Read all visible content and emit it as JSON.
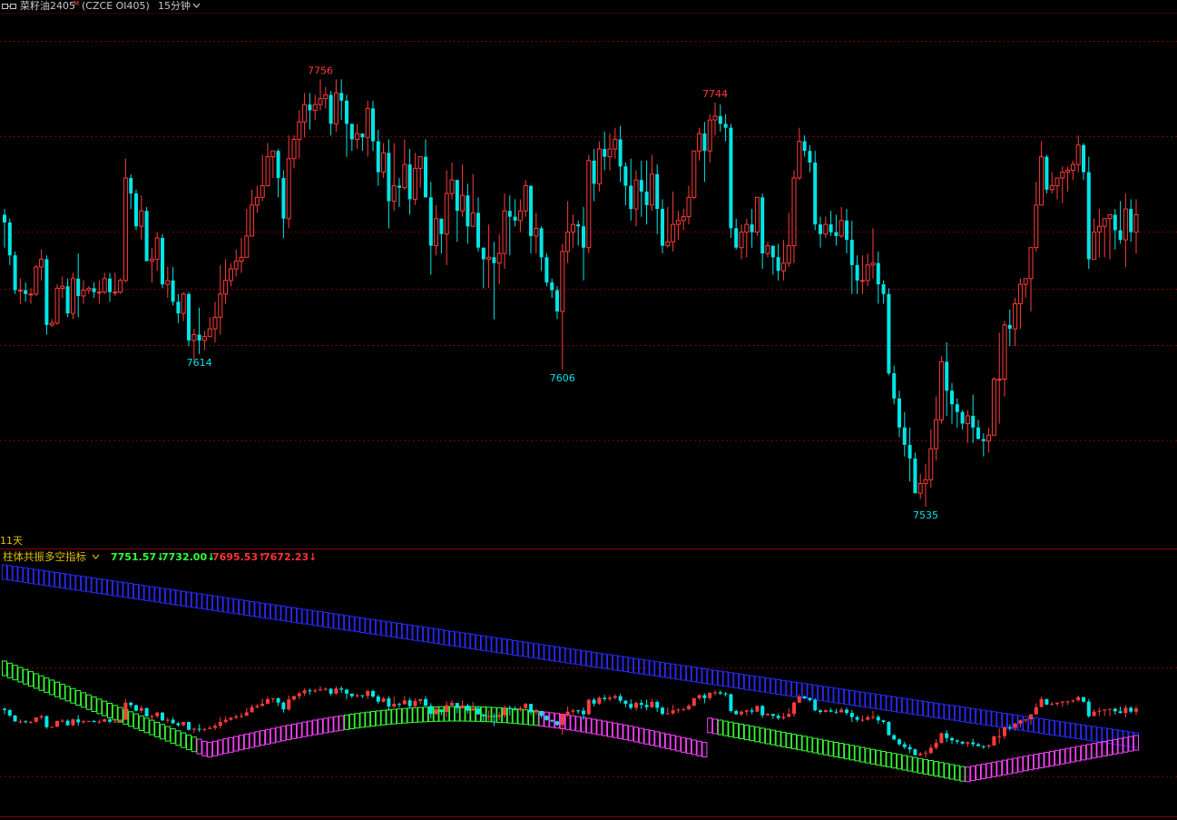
{
  "header": {
    "icon": "link-icon",
    "symbol_name": "菜籽油2405",
    "symbol_sup": "M",
    "exchange_code": "(CZCE OI405)",
    "period": "15分钟",
    "period_icon": "chevron-down-icon"
  },
  "main_panel": {
    "corner_label": "11天",
    "colors": {
      "up": "#ff3b3b",
      "down": "#00e5e5",
      "grid": "#7a0000",
      "background": "#000000"
    }
  },
  "indicator_panel": {
    "title": "柱体共振多空指标",
    "title_icon": "chevron-down-icon",
    "values": [
      {
        "text": "7751.57↓",
        "color": "#33ff33"
      },
      {
        "text": "7732.00↓",
        "color": "#33ff33"
      },
      {
        "text": "7695.53↑",
        "color": "#ff3333"
      },
      {
        "text": "7672.23↓",
        "color": "#ff3333"
      }
    ],
    "band_colors": {
      "slow": "#2a2aff",
      "fast_up": "#ff40ff",
      "fast_down": "#33ff33"
    }
  },
  "chart_data": {
    "type": "candlestick",
    "title": "菜籽油2405 15分钟",
    "y_range": [
      7520,
      7790
    ],
    "annotations": [
      {
        "label": "7756",
        "value": 7756,
        "kind": "high"
      },
      {
        "label": "7614",
        "value": 7614,
        "kind": "low"
      },
      {
        "label": "7606",
        "value": 7606,
        "kind": "low"
      },
      {
        "label": "7744",
        "value": 7744,
        "kind": "high"
      },
      {
        "label": "7535",
        "value": 7535,
        "kind": "low"
      }
    ],
    "candles": [
      [
        7686,
        7682,
        7689,
        7669
      ],
      [
        7682,
        7665,
        7684,
        7660
      ],
      [
        7665,
        7647,
        7667,
        7645
      ],
      [
        7647,
        7647,
        7653,
        7640
      ],
      [
        7647,
        7645,
        7651,
        7641
      ],
      [
        7645,
        7645,
        7648,
        7640
      ],
      [
        7645,
        7659,
        7660,
        7644
      ],
      [
        7659,
        7663,
        7668,
        7652
      ],
      [
        7663,
        7629,
        7665,
        7624
      ],
      [
        7629,
        7630,
        7632,
        7628
      ],
      [
        7630,
        7648,
        7650,
        7629
      ],
      [
        7648,
        7649,
        7654,
        7643
      ],
      [
        7649,
        7635,
        7653,
        7633
      ],
      [
        7635,
        7653,
        7656,
        7632
      ],
      [
        7653,
        7644,
        7666,
        7633
      ],
      [
        7644,
        7647,
        7652,
        7640
      ],
      [
        7647,
        7648,
        7649,
        7645
      ],
      [
        7648,
        7646,
        7651,
        7643
      ],
      [
        7646,
        7646,
        7652,
        7640
      ],
      [
        7646,
        7653,
        7656,
        7645
      ],
      [
        7653,
        7646,
        7656,
        7641
      ],
      [
        7646,
        7646,
        7656,
        7644
      ],
      [
        7646,
        7652,
        7653,
        7645
      ],
      [
        7652,
        7705,
        7715,
        7651
      ],
      [
        7705,
        7697,
        7707,
        7689
      ],
      [
        7697,
        7680,
        7699,
        7678
      ],
      [
        7680,
        7688,
        7696,
        7673
      ],
      [
        7688,
        7662,
        7690,
        7662
      ],
      [
        7662,
        7663,
        7669,
        7651
      ],
      [
        7663,
        7674,
        7677,
        7657
      ],
      [
        7674,
        7650,
        7676,
        7648
      ],
      [
        7650,
        7652,
        7659,
        7643
      ],
      [
        7652,
        7641,
        7659,
        7639
      ],
      [
        7641,
        7635,
        7645,
        7630
      ],
      [
        7635,
        7645,
        7646,
        7631
      ],
      [
        7645,
        7621,
        7646,
        7618
      ],
      [
        7621,
        7624,
        7627,
        7611
      ],
      [
        7624,
        7621,
        7638,
        7614
      ],
      [
        7621,
        7623,
        7626,
        7616
      ],
      [
        7623,
        7627,
        7633,
        7627
      ],
      [
        7627,
        7633,
        7641,
        7620
      ],
      [
        7633,
        7645,
        7660,
        7624
      ],
      [
        7645,
        7652,
        7663,
        7640
      ],
      [
        7652,
        7658,
        7661,
        7649
      ],
      [
        7658,
        7662,
        7668,
        7654
      ],
      [
        7662,
        7664,
        7674,
        7656
      ],
      [
        7664,
        7675,
        7689,
        7671
      ],
      [
        7675,
        7691,
        7699,
        7680
      ],
      [
        7691,
        7695,
        7701,
        7687
      ],
      [
        7695,
        7701,
        7717,
        7693
      ],
      [
        7701,
        7716,
        7723,
        7707
      ],
      [
        7716,
        7719,
        7719,
        7705
      ],
      [
        7719,
        7705,
        7720,
        7695
      ],
      [
        7705,
        7684,
        7709,
        7674
      ],
      [
        7684,
        7715,
        7727,
        7679
      ],
      [
        7715,
        7725,
        7727,
        7710
      ],
      [
        7725,
        7734,
        7740,
        7715
      ],
      [
        7734,
        7743,
        7749,
        7726
      ],
      [
        7743,
        7740,
        7749,
        7730
      ],
      [
        7740,
        7743,
        7748,
        7735
      ],
      [
        7743,
        7746,
        7756,
        7740
      ],
      [
        7746,
        7748,
        7752,
        7741
      ],
      [
        7748,
        7733,
        7750,
        7727
      ],
      [
        7733,
        7749,
        7756,
        7729
      ],
      [
        7749,
        7745,
        7756,
        7735
      ],
      [
        7745,
        7733,
        7748,
        7716
      ],
      [
        7733,
        7725,
        7733,
        7719
      ],
      [
        7725,
        7728,
        7733,
        7720
      ],
      [
        7728,
        7726,
        7728,
        7719
      ],
      [
        7726,
        7741,
        7745,
        7716
      ],
      [
        7741,
        7724,
        7745,
        7719
      ],
      [
        7724,
        7708,
        7730,
        7701
      ],
      [
        7708,
        7718,
        7723,
        7705
      ],
      [
        7718,
        7693,
        7725,
        7679
      ],
      [
        7693,
        7701,
        7723,
        7688
      ],
      [
        7701,
        7700,
        7705,
        7690
      ],
      [
        7700,
        7712,
        7725,
        7699
      ],
      [
        7712,
        7694,
        7720,
        7686
      ],
      [
        7694,
        7710,
        7718,
        7691
      ],
      [
        7710,
        7716,
        7716,
        7700
      ],
      [
        7716,
        7695,
        7725,
        7695
      ],
      [
        7695,
        7670,
        7703,
        7655
      ],
      [
        7670,
        7684,
        7691,
        7665
      ],
      [
        7684,
        7676,
        7678,
        7666
      ],
      [
        7676,
        7697,
        7709,
        7660
      ],
      [
        7697,
        7704,
        7713,
        7694
      ],
      [
        7704,
        7688,
        7704,
        7672
      ],
      [
        7688,
        7696,
        7712,
        7685
      ],
      [
        7696,
        7680,
        7702,
        7671
      ],
      [
        7680,
        7687,
        7707,
        7680
      ],
      [
        7687,
        7669,
        7695,
        7667
      ],
      [
        7669,
        7663,
        7669,
        7648
      ],
      [
        7663,
        7664,
        7681,
        7648
      ],
      [
        7664,
        7661,
        7672,
        7632
      ],
      [
        7661,
        7666,
        7676,
        7650
      ],
      [
        7666,
        7688,
        7697,
        7658
      ],
      [
        7688,
        7685,
        7696,
        7665
      ],
      [
        7685,
        7683,
        7694,
        7680
      ],
      [
        7683,
        7688,
        7694,
        7677
      ],
      [
        7688,
        7701,
        7704,
        7685
      ],
      [
        7701,
        7675,
        7701,
        7666
      ],
      [
        7675,
        7679,
        7687,
        7666
      ],
      [
        7679,
        7664,
        7680,
        7657
      ],
      [
        7664,
        7651,
        7666,
        7649
      ],
      [
        7651,
        7647,
        7653,
        7643
      ],
      [
        7647,
        7636,
        7649,
        7632
      ],
      [
        7636,
        7667,
        7671,
        7606
      ],
      [
        7667,
        7677,
        7693,
        7661
      ],
      [
        7677,
        7681,
        7686,
        7669
      ],
      [
        7681,
        7680,
        7683,
        7670
      ],
      [
        7680,
        7669,
        7690,
        7652
      ],
      [
        7669,
        7714,
        7717,
        7666
      ],
      [
        7714,
        7702,
        7720,
        7693
      ],
      [
        7702,
        7720,
        7724,
        7698
      ],
      [
        7720,
        7716,
        7729,
        7709
      ],
      [
        7716,
        7720,
        7728,
        7709
      ],
      [
        7720,
        7725,
        7731,
        7715
      ],
      [
        7725,
        7711,
        7732,
        7703
      ],
      [
        7711,
        7701,
        7713,
        7691
      ],
      [
        7701,
        7689,
        7715,
        7683
      ],
      [
        7689,
        7704,
        7709,
        7680
      ],
      [
        7704,
        7698,
        7714,
        7685
      ],
      [
        7698,
        7691,
        7714,
        7681
      ],
      [
        7691,
        7707,
        7717,
        7688
      ],
      [
        7707,
        7689,
        7712,
        7676
      ],
      [
        7689,
        7670,
        7694,
        7666
      ],
      [
        7670,
        7672,
        7690,
        7669
      ],
      [
        7672,
        7681,
        7698,
        7667
      ],
      [
        7681,
        7683,
        7688,
        7673
      ],
      [
        7683,
        7685,
        7689,
        7678
      ],
      [
        7685,
        7695,
        7701,
        7681
      ],
      [
        7695,
        7719,
        7719,
        7694
      ],
      [
        7719,
        7728,
        7731,
        7714
      ],
      [
        7728,
        7719,
        7734,
        7703
      ],
      [
        7719,
        7735,
        7738,
        7713
      ],
      [
        7735,
        7737,
        7744,
        7727
      ],
      [
        7737,
        7733,
        7743,
        7729
      ],
      [
        7733,
        7731,
        7738,
        7724
      ],
      [
        7731,
        7679,
        7733,
        7674
      ],
      [
        7679,
        7669,
        7684,
        7668
      ],
      [
        7669,
        7677,
        7681,
        7663
      ],
      [
        7677,
        7681,
        7684,
        7664
      ],
      [
        7681,
        7677,
        7689,
        7669
      ],
      [
        7677,
        7695,
        7695,
        7675
      ],
      [
        7695,
        7666,
        7697,
        7658
      ],
      [
        7666,
        7670,
        7672,
        7664
      ],
      [
        7670,
        7664,
        7670,
        7655
      ],
      [
        7664,
        7657,
        7671,
        7652
      ],
      [
        7657,
        7661,
        7673,
        7652
      ],
      [
        7661,
        7670,
        7687,
        7659
      ],
      [
        7670,
        7705,
        7709,
        7661
      ],
      [
        7705,
        7724,
        7731,
        7704
      ],
      [
        7724,
        7719,
        7727,
        7716
      ],
      [
        7719,
        7713,
        7722,
        7708
      ],
      [
        7713,
        7681,
        7719,
        7678
      ],
      [
        7681,
        7676,
        7685,
        7669
      ],
      [
        7676,
        7681,
        7685,
        7674
      ],
      [
        7681,
        7677,
        7688,
        7675
      ],
      [
        7677,
        7675,
        7686,
        7670
      ],
      [
        7675,
        7683,
        7690,
        7674
      ],
      [
        7683,
        7673,
        7689,
        7666
      ],
      [
        7673,
        7660,
        7683,
        7645
      ],
      [
        7660,
        7652,
        7665,
        7645
      ],
      [
        7652,
        7652,
        7665,
        7645
      ],
      [
        7652,
        7660,
        7666,
        7649
      ],
      [
        7660,
        7661,
        7679,
        7653
      ],
      [
        7661,
        7650,
        7667,
        7640
      ],
      [
        7650,
        7645,
        7652,
        7640
      ],
      [
        7645,
        7604,
        7648,
        7603
      ],
      [
        7604,
        7591,
        7608,
        7588
      ],
      [
        7591,
        7576,
        7595,
        7571
      ],
      [
        7576,
        7567,
        7584,
        7561
      ],
      [
        7567,
        7560,
        7576,
        7548
      ],
      [
        7560,
        7542,
        7563,
        7542
      ],
      [
        7542,
        7547,
        7552,
        7539
      ],
      [
        7547,
        7549,
        7557,
        7535
      ],
      [
        7549,
        7565,
        7575,
        7545
      ],
      [
        7565,
        7580,
        7592,
        7559
      ],
      [
        7580,
        7610,
        7613,
        7578
      ],
      [
        7610,
        7595,
        7620,
        7582
      ],
      [
        7595,
        7588,
        7599,
        7578
      ],
      [
        7588,
        7584,
        7591,
        7576
      ],
      [
        7584,
        7578,
        7585,
        7575
      ],
      [
        7578,
        7582,
        7585,
        7568
      ],
      [
        7582,
        7576,
        7593,
        7568
      ],
      [
        7576,
        7570,
        7580,
        7570
      ],
      [
        7570,
        7569,
        7573,
        7561
      ],
      [
        7569,
        7572,
        7576,
        7563
      ],
      [
        7572,
        7601,
        7602,
        7582
      ],
      [
        7601,
        7601,
        7625,
        7578
      ],
      [
        7601,
        7629,
        7631,
        7592
      ],
      [
        7629,
        7627,
        7637,
        7618
      ],
      [
        7627,
        7640,
        7643,
        7618
      ],
      [
        7640,
        7650,
        7653,
        7627
      ],
      [
        7650,
        7653,
        7653,
        7643
      ],
      [
        7653,
        7669,
        7666,
        7636
      ],
      [
        7669,
        7691,
        7703,
        7667
      ],
      [
        7691,
        7716,
        7724,
        7709
      ],
      [
        7716,
        7699,
        7717,
        7697
      ],
      [
        7699,
        7701,
        7708,
        7697
      ],
      [
        7701,
        7705,
        7705,
        7694
      ],
      [
        7705,
        7708,
        7711,
        7692
      ],
      [
        7708,
        7709,
        7711,
        7698
      ],
      [
        7709,
        7712,
        7714,
        7704
      ],
      [
        7712,
        7722,
        7727,
        7708
      ],
      [
        7722,
        7708,
        7723,
        7704
      ],
      [
        7708,
        7663,
        7716,
        7658
      ],
      [
        7663,
        7677,
        7684,
        7667
      ],
      [
        7677,
        7680,
        7689,
        7664
      ],
      [
        7680,
        7684,
        7679,
        7664
      ],
      [
        7684,
        7686,
        7686,
        7663
      ],
      [
        7686,
        7678,
        7689,
        7668
      ],
      [
        7678,
        7673,
        7693,
        7671
      ],
      [
        7673,
        7689,
        7697,
        7659
      ],
      [
        7689,
        7677,
        7694,
        7672
      ],
      [
        7677,
        7686,
        7694,
        7666
      ]
    ],
    "indicator": {
      "name": "柱体共振多空指标",
      "series": [
        {
          "name": "7751.57↓",
          "color": "#2a2aff",
          "start": 7792,
          "end": 7700
        },
        {
          "name": "7732.00↓",
          "color": "#33ff33",
          "start": 7735,
          "end": 7690
        },
        {
          "name": "7695.53↑",
          "color": "#ff3333",
          "start": 7690,
          "end": 7705
        },
        {
          "name": "7672.23↓",
          "color": "#ff40ff",
          "start": 7680,
          "end": 7690
        }
      ]
    }
  }
}
